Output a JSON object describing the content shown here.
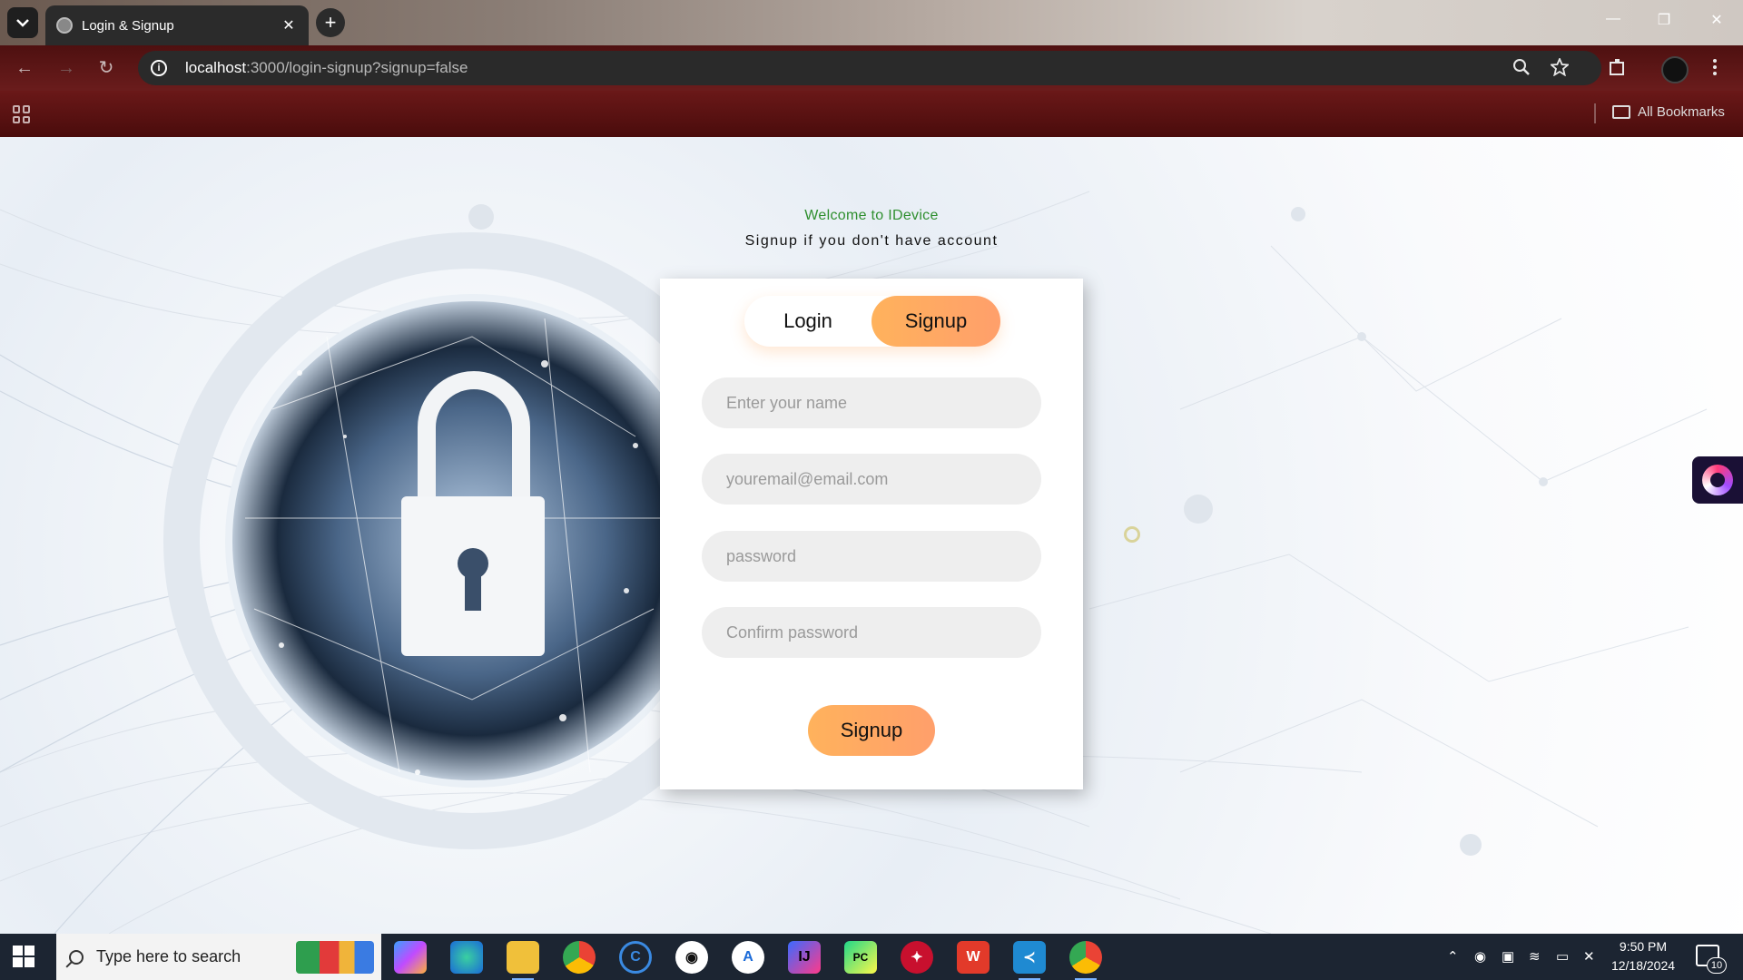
{
  "browser": {
    "tab_title": "Login & Signup",
    "tab_close": "✕",
    "new_tab": "+",
    "url_host": "localhost",
    "url_rest": ":3000/login-signup?signup=false",
    "bookmarks_label": "All Bookmarks",
    "window_controls": [
      "—",
      "❐",
      "✕"
    ]
  },
  "page": {
    "welcome": "Welcome to IDevice",
    "subtitle": "Signup if you don't have account",
    "toggle": {
      "login": "Login",
      "signup": "Signup",
      "active": "signup"
    },
    "fields": {
      "name_placeholder": "Enter your name",
      "email_placeholder": "youremail@email.com",
      "password_placeholder": "password",
      "confirm_placeholder": "Confirm password"
    },
    "submit_label": "Signup"
  },
  "taskbar": {
    "search_placeholder": "Type here to search",
    "apps": [
      "copilot",
      "edge",
      "file-explorer",
      "chrome",
      "ccleaner",
      "github",
      "app-store",
      "intellij",
      "pycharm",
      "game-app",
      "wps-office",
      "vscode",
      "chrome-active"
    ],
    "time": "9:50 PM",
    "date": "12/18/2024",
    "notifications": "10"
  },
  "colors": {
    "accent_start": "#ffb25c",
    "accent_end": "#ff9f6b",
    "welcome_green": "#2f8f2f",
    "toolbar_red": "#5a1515"
  }
}
